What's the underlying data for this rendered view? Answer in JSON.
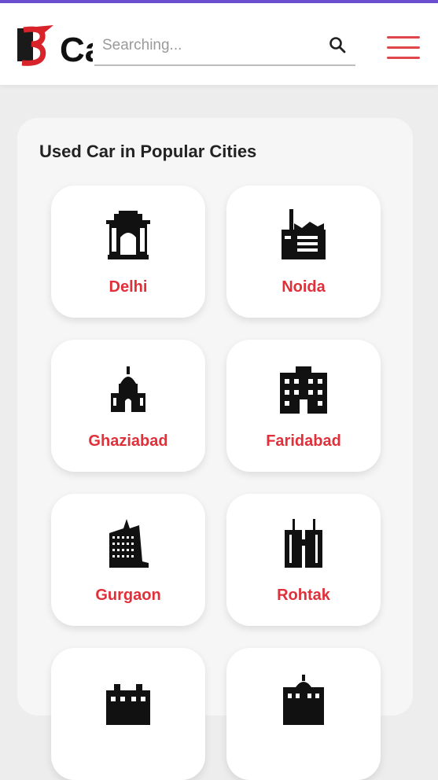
{
  "header": {
    "logo_text": "Ca",
    "search_placeholder": "Searching...",
    "accent_color": "#6a4fd0",
    "menu_color": "#e0474c"
  },
  "section": {
    "title": "Used Car in Popular Cities"
  },
  "cities": [
    {
      "name": "Delhi",
      "icon": "india-gate-icon"
    },
    {
      "name": "Noida",
      "icon": "factory-icon"
    },
    {
      "name": "Ghaziabad",
      "icon": "church-icon"
    },
    {
      "name": "Faridabad",
      "icon": "apartment-building-icon"
    },
    {
      "name": "Gurgaon",
      "icon": "skyscraper-icon"
    },
    {
      "name": "Rohtak",
      "icon": "twin-towers-icon"
    },
    {
      "name": "",
      "icon": "building-icon"
    },
    {
      "name": "",
      "icon": "palace-icon"
    }
  ],
  "colors": {
    "city_label": "#e0303a"
  }
}
